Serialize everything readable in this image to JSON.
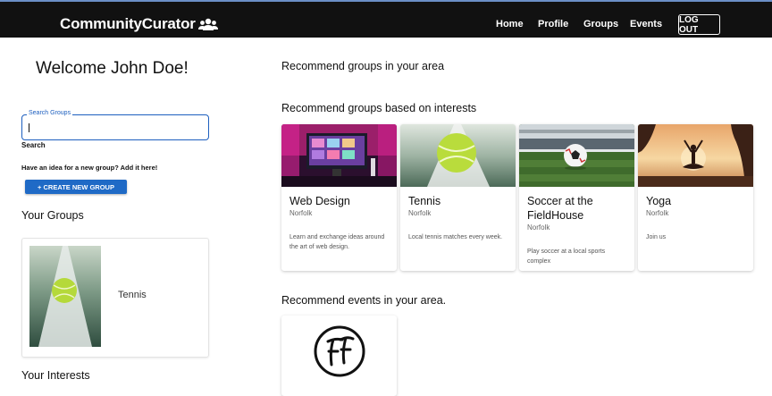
{
  "header": {
    "brand": "CommunityCurator",
    "nav": [
      "Home",
      "Profile",
      "Groups",
      "Events"
    ],
    "logout": "LOG OUT"
  },
  "sidebar": {
    "welcome": "Welcome John Doe!",
    "search": {
      "legend": "Search Groups",
      "value": "",
      "label": "Search"
    },
    "idea_text": "Have an idea for a new group? Add it here!",
    "create_button": "+ CREATE NEW GROUP",
    "your_groups_title": "Your Groups",
    "your_groups": [
      {
        "name": "Tennis"
      }
    ],
    "your_interests_title": "Your Interests"
  },
  "main": {
    "area_title": "Recommend groups in your area",
    "interests_title": "Recommend groups based on interests",
    "groups": [
      {
        "title": "Web Design",
        "location": "Norfolk",
        "description": "Learn and exchange ideas around the art of web design."
      },
      {
        "title": "Tennis",
        "location": "Norfolk",
        "description": "Local tennis matches every week."
      },
      {
        "title": "Soccer at the FieldHouse",
        "location": "Norfolk",
        "description": "Play soccer at a local sports complex"
      },
      {
        "title": "Yoga",
        "location": "Norfolk",
        "description": "Join us"
      }
    ],
    "events_title": "Recommend events in your area.",
    "events": [
      {
        "logo_text": "FF"
      }
    ]
  },
  "colors": {
    "topbar": "#111111",
    "accent": "#1f6ac6",
    "search_border": "#1d5fbf"
  }
}
